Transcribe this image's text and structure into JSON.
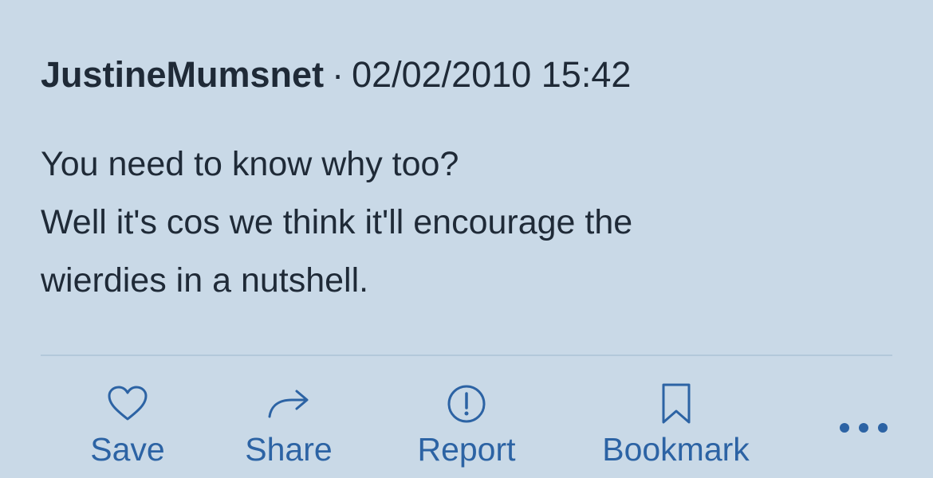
{
  "post": {
    "author": "JustineMumsnet",
    "separator": "·",
    "timestamp": "02/02/2010 15:42",
    "body_lines": [
      "You need to know why too?",
      "Well it's cos we think it'll encourage the",
      "wierdies in a nutshell."
    ]
  },
  "actions": {
    "save_label": "Save",
    "share_label": "Share",
    "report_label": "Report",
    "bookmark_label": "Bookmark",
    "more_icon": "more-horizontal-icon"
  },
  "colors": {
    "background": "#c9d9e7",
    "text": "#1f2a37",
    "accent": "#2c63a4",
    "divider": "#b3c8da"
  }
}
